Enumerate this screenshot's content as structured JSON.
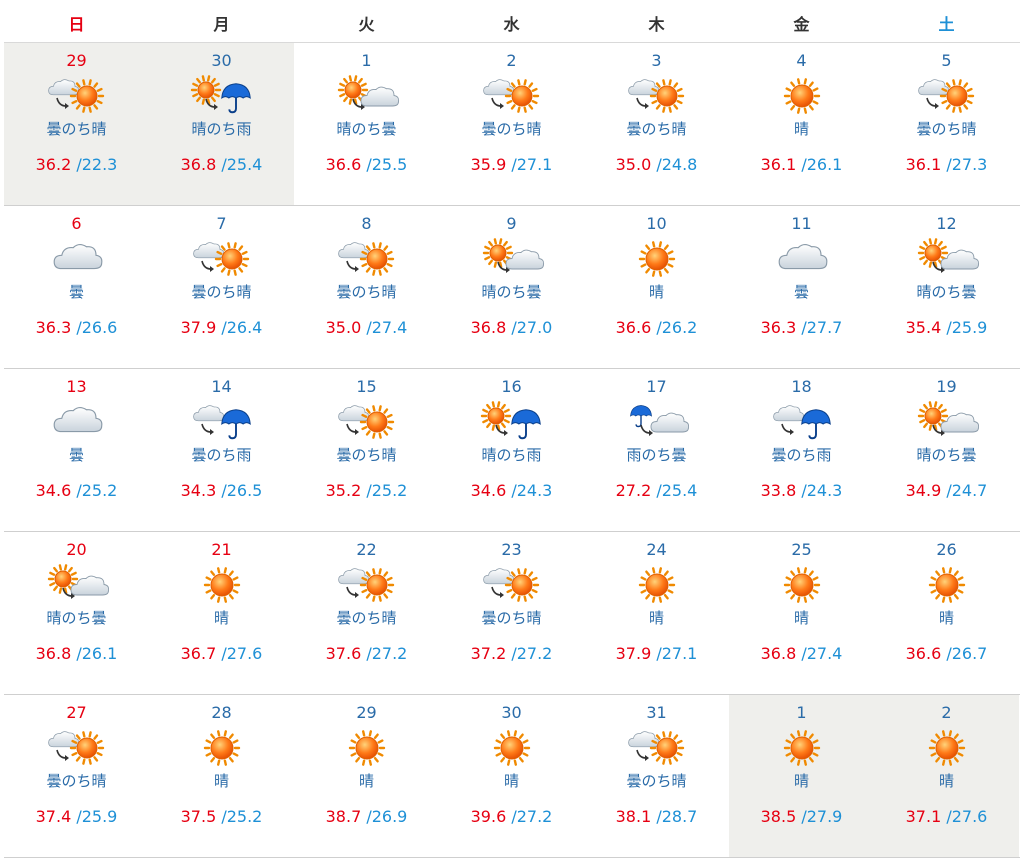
{
  "weekdays": [
    {
      "label": "日",
      "kind": "sun"
    },
    {
      "label": "月",
      "kind": "wd"
    },
    {
      "label": "火",
      "kind": "wd"
    },
    {
      "label": "水",
      "kind": "wd"
    },
    {
      "label": "木",
      "kind": "wd"
    },
    {
      "label": "金",
      "kind": "wd"
    },
    {
      "label": "土",
      "kind": "sat"
    }
  ],
  "colors": {
    "holiday_red": "#e60012",
    "date_blue": "#2a6ba8",
    "min_blue": "#1e90d6",
    "other_month_bg": "#efefec"
  },
  "weeks": [
    [
      {
        "date": "29",
        "red": true,
        "other": true,
        "weather": "曇のち晴",
        "icon": "cloud-then-sun-icon",
        "max": "36.2",
        "min": "22.3"
      },
      {
        "date": "30",
        "red": false,
        "other": true,
        "weather": "晴のち雨",
        "icon": "sun-then-rain-icon",
        "max": "36.8",
        "min": "25.4"
      },
      {
        "date": "1",
        "red": false,
        "other": false,
        "weather": "晴のち曇",
        "icon": "sun-then-cloud-icon",
        "max": "36.6",
        "min": "25.5"
      },
      {
        "date": "2",
        "red": false,
        "other": false,
        "weather": "曇のち晴",
        "icon": "cloud-then-sun-icon",
        "max": "35.9",
        "min": "27.1"
      },
      {
        "date": "3",
        "red": false,
        "other": false,
        "weather": "曇のち晴",
        "icon": "cloud-then-sun-icon",
        "max": "35.0",
        "min": "24.8"
      },
      {
        "date": "4",
        "red": false,
        "other": false,
        "weather": "晴",
        "icon": "sun-icon",
        "max": "36.1",
        "min": "26.1"
      },
      {
        "date": "5",
        "red": false,
        "other": false,
        "weather": "曇のち晴",
        "icon": "cloud-then-sun-icon",
        "max": "36.1",
        "min": "27.3"
      }
    ],
    [
      {
        "date": "6",
        "red": true,
        "other": false,
        "weather": "曇",
        "icon": "cloud-icon",
        "max": "36.3",
        "min": "26.6"
      },
      {
        "date": "7",
        "red": false,
        "other": false,
        "weather": "曇のち晴",
        "icon": "cloud-then-sun-icon",
        "max": "37.9",
        "min": "26.4"
      },
      {
        "date": "8",
        "red": false,
        "other": false,
        "weather": "曇のち晴",
        "icon": "cloud-then-sun-icon",
        "max": "35.0",
        "min": "27.4"
      },
      {
        "date": "9",
        "red": false,
        "other": false,
        "weather": "晴のち曇",
        "icon": "sun-then-cloud-icon",
        "max": "36.8",
        "min": "27.0"
      },
      {
        "date": "10",
        "red": false,
        "other": false,
        "weather": "晴",
        "icon": "sun-icon",
        "max": "36.6",
        "min": "26.2"
      },
      {
        "date": "11",
        "red": false,
        "other": false,
        "weather": "曇",
        "icon": "cloud-icon",
        "max": "36.3",
        "min": "27.7"
      },
      {
        "date": "12",
        "red": false,
        "other": false,
        "weather": "晴のち曇",
        "icon": "sun-then-cloud-icon",
        "max": "35.4",
        "min": "25.9"
      }
    ],
    [
      {
        "date": "13",
        "red": true,
        "other": false,
        "weather": "曇",
        "icon": "cloud-icon",
        "max": "34.6",
        "min": "25.2"
      },
      {
        "date": "14",
        "red": false,
        "other": false,
        "weather": "曇のち雨",
        "icon": "cloud-then-rain-icon",
        "max": "34.3",
        "min": "26.5"
      },
      {
        "date": "15",
        "red": false,
        "other": false,
        "weather": "曇のち晴",
        "icon": "cloud-then-sun-icon",
        "max": "35.2",
        "min": "25.2"
      },
      {
        "date": "16",
        "red": false,
        "other": false,
        "weather": "晴のち雨",
        "icon": "sun-then-rain-icon",
        "max": "34.6",
        "min": "24.3"
      },
      {
        "date": "17",
        "red": false,
        "other": false,
        "weather": "雨のち曇",
        "icon": "rain-then-cloud-icon",
        "max": "27.2",
        "min": "25.4"
      },
      {
        "date": "18",
        "red": false,
        "other": false,
        "weather": "曇のち雨",
        "icon": "cloud-then-rain-icon",
        "max": "33.8",
        "min": "24.3"
      },
      {
        "date": "19",
        "red": false,
        "other": false,
        "weather": "晴のち曇",
        "icon": "sun-then-cloud-icon",
        "max": "34.9",
        "min": "24.7"
      }
    ],
    [
      {
        "date": "20",
        "red": true,
        "other": false,
        "weather": "晴のち曇",
        "icon": "sun-then-cloud-icon",
        "max": "36.8",
        "min": "26.1"
      },
      {
        "date": "21",
        "red": true,
        "other": false,
        "weather": "晴",
        "icon": "sun-icon",
        "max": "36.7",
        "min": "27.6"
      },
      {
        "date": "22",
        "red": false,
        "other": false,
        "weather": "曇のち晴",
        "icon": "cloud-then-sun-icon",
        "max": "37.6",
        "min": "27.2"
      },
      {
        "date": "23",
        "red": false,
        "other": false,
        "weather": "曇のち晴",
        "icon": "cloud-then-sun-icon",
        "max": "37.2",
        "min": "27.2"
      },
      {
        "date": "24",
        "red": false,
        "other": false,
        "weather": "晴",
        "icon": "sun-icon",
        "max": "37.9",
        "min": "27.1"
      },
      {
        "date": "25",
        "red": false,
        "other": false,
        "weather": "晴",
        "icon": "sun-icon",
        "max": "36.8",
        "min": "27.4"
      },
      {
        "date": "26",
        "red": false,
        "other": false,
        "weather": "晴",
        "icon": "sun-icon",
        "max": "36.6",
        "min": "26.7"
      }
    ],
    [
      {
        "date": "27",
        "red": true,
        "other": false,
        "weather": "曇のち晴",
        "icon": "cloud-then-sun-icon",
        "max": "37.4",
        "min": "25.9"
      },
      {
        "date": "28",
        "red": false,
        "other": false,
        "weather": "晴",
        "icon": "sun-icon",
        "max": "37.5",
        "min": "25.2"
      },
      {
        "date": "29",
        "red": false,
        "other": false,
        "weather": "晴",
        "icon": "sun-icon",
        "max": "38.7",
        "min": "26.9"
      },
      {
        "date": "30",
        "red": false,
        "other": false,
        "weather": "晴",
        "icon": "sun-icon",
        "max": "39.6",
        "min": "27.2"
      },
      {
        "date": "31",
        "red": false,
        "other": false,
        "weather": "曇のち晴",
        "icon": "cloud-then-sun-icon",
        "max": "38.1",
        "min": "28.7"
      },
      {
        "date": "1",
        "red": false,
        "other": true,
        "weather": "晴",
        "icon": "sun-icon",
        "max": "38.5",
        "min": "27.9"
      },
      {
        "date": "2",
        "red": false,
        "other": true,
        "weather": "晴",
        "icon": "sun-icon",
        "max": "37.1",
        "min": "27.6"
      }
    ]
  ]
}
